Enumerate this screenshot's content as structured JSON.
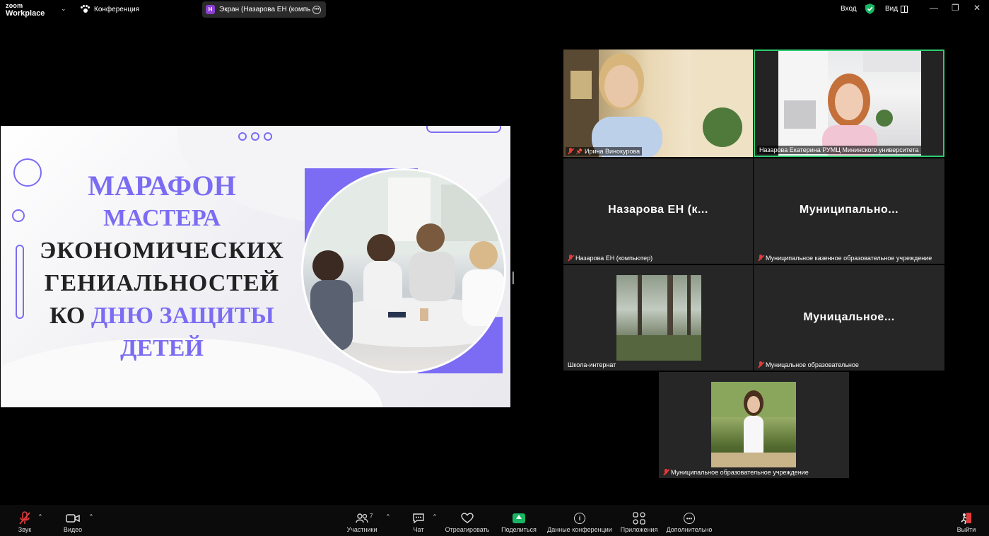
{
  "topbar": {
    "logo_line1": "zoom",
    "logo_line2": "Workplace",
    "conference_label": "Конференция",
    "screen_tab_badge": "Н",
    "screen_tab_label": "Экран (Назарова ЕН (компьютер",
    "login_label": "Вход",
    "view_label": "Вид",
    "minimize": "—",
    "restore": "❐",
    "close": "✕"
  },
  "slide": {
    "line1": "Марафон",
    "line2": "мастера",
    "line3": "экономических",
    "line4": "гениальностей",
    "line5_a": "ко ",
    "line5_b": "дню защиты",
    "line6": "детей"
  },
  "participants": {
    "tile1_name": "Ирина Винокурова",
    "tile2_name": "Назарова Екатерина РУМЦ Мининского университета",
    "tile3_big": "Назарова ЕН (к...",
    "tile3_name": "Назарова ЕН (компьютер)",
    "tile4_big": "Муниципально...",
    "tile4_name": "Муниципальное казенное образовательное учреждение",
    "tile5_name": "Школа-интернат",
    "tile6_big": "Муницальное...",
    "tile6_name": "Муницальное образовательное",
    "tile7_name": "Муниципальное образовательное учреждение"
  },
  "toolbar": {
    "audio": "Звук",
    "video": "Видео",
    "participants": "Участники",
    "participants_count": "7",
    "chat": "Чат",
    "react": "Отреагировать",
    "share": "Поделиться",
    "meeting_info": "Данные конференции",
    "apps": "Приложения",
    "more": "Дополнительно",
    "leave": "Выйти"
  },
  "colors": {
    "accent_purple": "#7b6cf3",
    "active_speaker": "#2ecc71",
    "share_green": "#18b664",
    "muted_red": "#e23b3b"
  }
}
